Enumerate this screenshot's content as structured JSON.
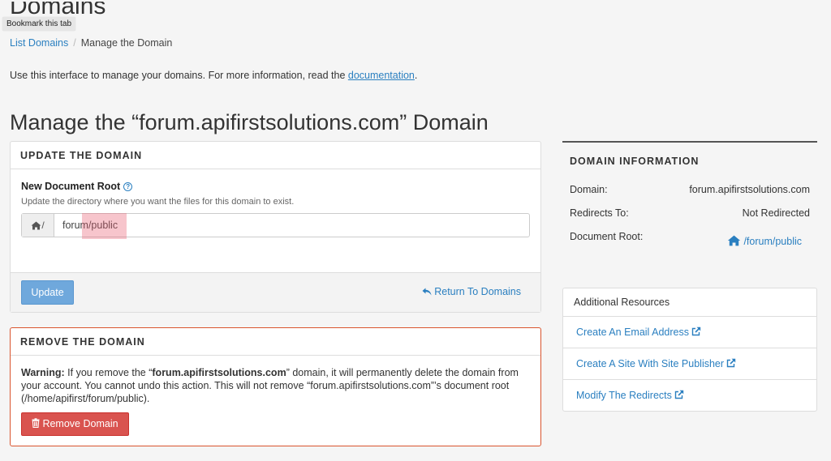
{
  "header": {
    "page_title": "Domains",
    "tooltip": "Bookmark this tab"
  },
  "breadcrumb": {
    "parent": "List Domains",
    "separator": "/",
    "current": "Manage the Domain"
  },
  "intro": {
    "text": "Use this interface to manage your domains. For more information, read the ",
    "link": "documentation",
    "suffix": "."
  },
  "main": {
    "title": "Manage the “forum.apifirstsolutions.com” Domain"
  },
  "update_panel": {
    "heading": "UPDATE THE DOMAIN",
    "field_label": "New Document Root",
    "field_help": "Update the directory where you want the files for this domain to exist.",
    "prefix": "/",
    "value": "forum/public",
    "update_button": "Update",
    "return_link": "Return To Domains"
  },
  "remove_panel": {
    "heading": "REMOVE THE DOMAIN",
    "warning_label": "Warning:",
    "warning_pre": " If you remove the “",
    "domain": "forum.apifirstsolutions.com",
    "warning_post": "” domain, it will permanently delete the domain from your account. You cannot undo this action. This will not remove “forum.apifirstsolutions.com”’s document root (/home/apifirst/forum/public).",
    "remove_button": "Remove Domain"
  },
  "domain_info": {
    "heading": "DOMAIN INFORMATION",
    "rows": [
      {
        "label": "Domain:",
        "value": "forum.apifirstsolutions.com"
      },
      {
        "label": "Redirects To:",
        "value": "Not Redirected"
      },
      {
        "label": "Document Root:",
        "value": "/forum/public"
      }
    ]
  },
  "resources": {
    "heading": "Additional Resources",
    "items": [
      {
        "label": "Create An Email Address"
      },
      {
        "label": "Create A Site With Site Publisher"
      },
      {
        "label": "Modify The Redirects"
      }
    ]
  },
  "colors": {
    "link": "#2a7fc0",
    "danger": "#d9534f",
    "primary_disabled": "#6fa8dc"
  }
}
